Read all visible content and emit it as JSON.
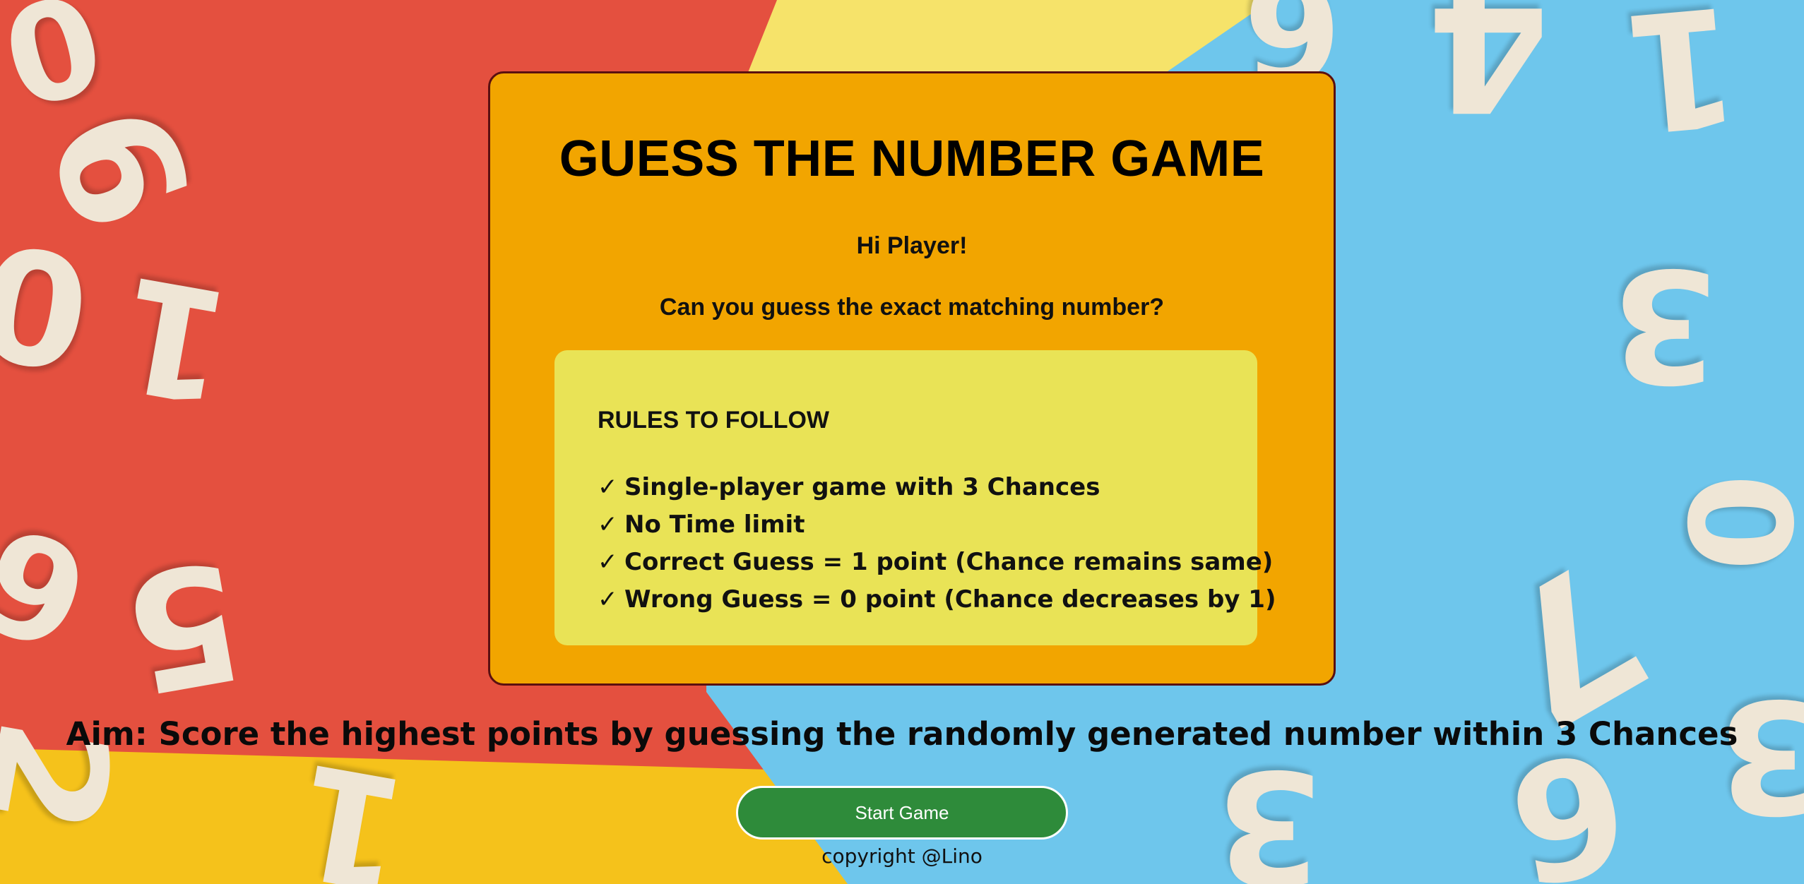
{
  "game": {
    "title": "GUESS THE NUMBER GAME",
    "greeting": "Hi Player!",
    "question": "Can you guess the exact matching number?"
  },
  "rules": {
    "heading": "RULES TO FOLLOW",
    "check_symbol": "✓",
    "items": [
      "Single-player game with 3 Chances",
      "No Time limit",
      "Correct Guess = 1 point (Chance remains same)",
      "Wrong Guess = 0 point (Chance decreases by 1)"
    ]
  },
  "aim": "Aim: Score the highest points by guessing the randomly generated number within 3 Chances",
  "start_button_label": "Start Game",
  "footer": {
    "copyright": "copyright @Lino"
  },
  "colors": {
    "card": "#f2a500",
    "card_border": "#5a1010",
    "rules_box": "#e9e356",
    "start_button": "#2e8b3a",
    "bg_red": "#e4503f",
    "bg_yellow": "#f6e36a",
    "bg_blue": "#6ec6ec",
    "bg_orange_yellow": "#f5c21b"
  }
}
